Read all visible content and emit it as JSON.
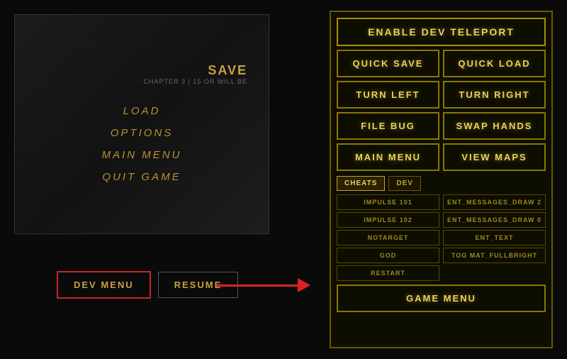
{
  "left_panel": {
    "save_label": "SAVE",
    "chapter_label": "CHAPTER 3  |  15 OR WILL BE",
    "menu_items": [
      {
        "label": "LOAD"
      },
      {
        "label": "OPTIONS"
      },
      {
        "label": "MAIN MENU"
      },
      {
        "label": "QUIT GAME"
      }
    ]
  },
  "bottom_buttons": {
    "dev_menu_label": "DEV MENU",
    "resume_label": "RESUME"
  },
  "right_panel": {
    "enable_dev_label": "ENABLE DEV TELEPORT",
    "enable_dev_bold": "DEV",
    "quick_save_label": "QUICK SAVE",
    "quick_load_label": "QUICK LOAD",
    "turn_left_label": "TURN LEFT",
    "turn_right_label": "TURN RIGHT",
    "file_bug_label": "FILE BUG",
    "swap_hands_label": "SWAP HANDS",
    "main_menu_label": "MAIN MENU",
    "view_maps_label": "VIEW MAPS",
    "cheats_tab_label": "CHEATS",
    "dev_tab_label": "DEV",
    "cheat_items_left": [
      "IMPULSE 101",
      "IMPULSE 102",
      "NOTARGET",
      "GOD",
      "RESTART"
    ],
    "cheat_items_right": [
      "ENT_MESSAGES_DRAW 2",
      "ENT_MESSAGES_DRAW 0",
      "ENT_TEXT",
      "TOG MAT_FULLBRIGHT"
    ],
    "game_menu_label": "GAME MENU"
  }
}
